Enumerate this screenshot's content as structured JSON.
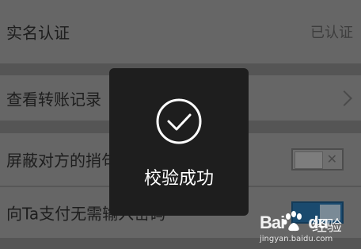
{
  "settings": {
    "rows": [
      {
        "label": "实名认证",
        "value": "已认证"
      },
      {
        "label": "查看转账记录"
      },
      {
        "label": "屏蔽对方的捎句话消息",
        "toggle": "off"
      },
      {
        "label": "向Ta支付无需输入密码",
        "toggle": "on"
      }
    ]
  },
  "toast": {
    "icon": "checkmark-circle-icon",
    "message": "校验成功"
  },
  "watermark": {
    "logo_left": "Bai",
    "logo_right": "du",
    "name": "经验",
    "url": "jingyan.baidu.com"
  },
  "colors": {
    "overlay_background": "#555555",
    "row_background": "#666666",
    "toast_background": "#1e1e1e",
    "toggle_on": "#1a4a6e"
  },
  "icons": {
    "chevron": "chevron-right-icon",
    "toggle_off_mark": "x-mark-icon"
  }
}
